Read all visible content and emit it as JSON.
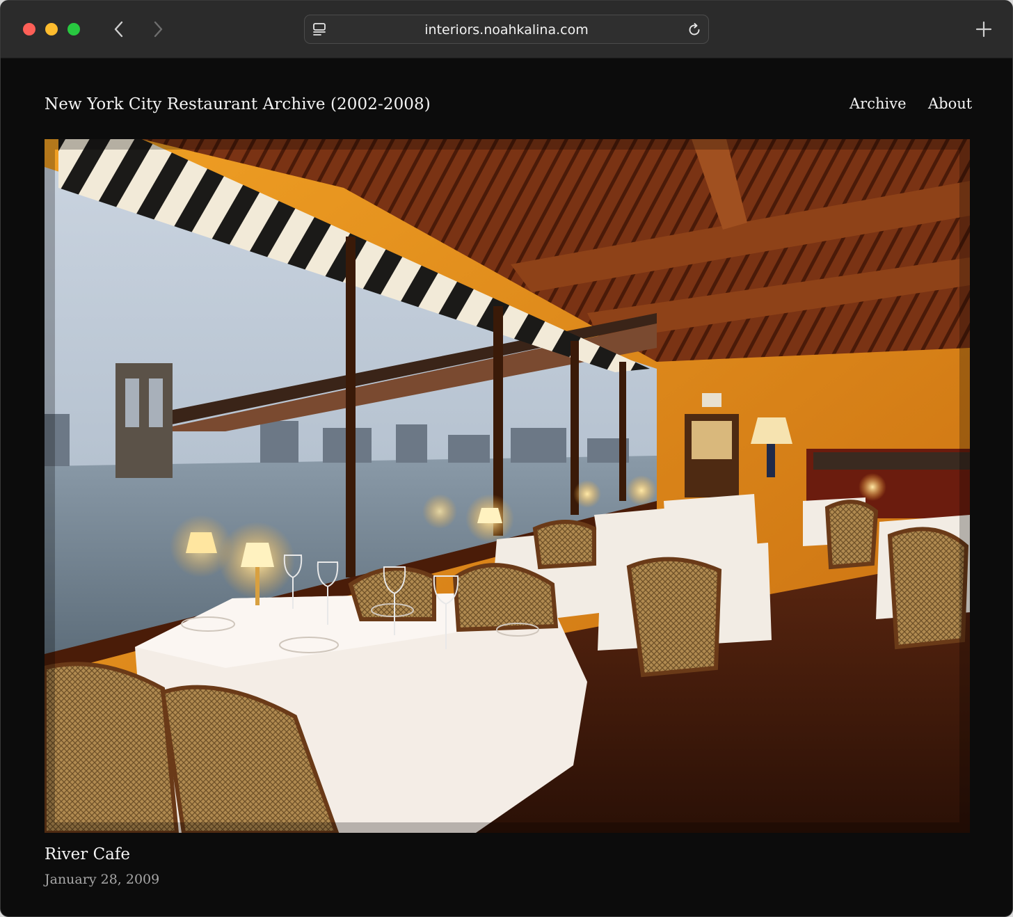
{
  "browser": {
    "url": "interiors.noahkalina.com",
    "icons": [
      "back-icon",
      "forward-icon",
      "page-icon",
      "reload-icon",
      "plus-icon"
    ]
  },
  "site": {
    "title": "New York City Restaurant Archive (2002-2008)",
    "nav": {
      "archive": "Archive",
      "about": "About"
    }
  },
  "post": {
    "title": "River Cafe",
    "date": "January 28, 2009",
    "photo_subject": "restaurant-interior-photo"
  },
  "colors": {
    "window_bg": "#0c0c0c",
    "toolbar_bg": "#2b2b2b",
    "text_primary": "#f4f4f4",
    "text_secondary": "#a8a8a8",
    "wall_amber": "#e08a1a",
    "ceiling_wood": "#6b2a10"
  }
}
